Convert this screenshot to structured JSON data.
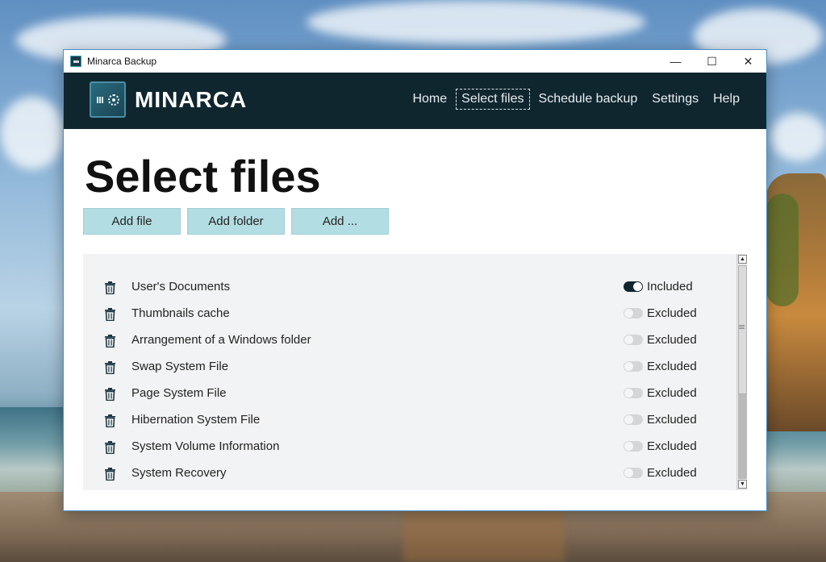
{
  "window": {
    "title": "Minarca Backup",
    "controls": {
      "minimize": "—",
      "maximize": "☐",
      "close": "✕"
    }
  },
  "header": {
    "brand": "MINARCA",
    "nav": [
      {
        "label": "Home",
        "active": false
      },
      {
        "label": "Select files",
        "active": true
      },
      {
        "label": "Schedule backup",
        "active": false
      },
      {
        "label": "Settings",
        "active": false
      },
      {
        "label": "Help",
        "active": false
      }
    ]
  },
  "page": {
    "title": "Select files",
    "buttons": {
      "add_file": "Add file",
      "add_folder": "Add folder",
      "add_more": "Add ..."
    }
  },
  "list": {
    "items": [
      {
        "label": "User's Documents",
        "status": "Included",
        "enabled": true
      },
      {
        "label": "Thumbnails cache",
        "status": "Excluded",
        "enabled": false
      },
      {
        "label": "Arrangement of a Windows folder",
        "status": "Excluded",
        "enabled": false
      },
      {
        "label": "Swap System File",
        "status": "Excluded",
        "enabled": false
      },
      {
        "label": "Page System File",
        "status": "Excluded",
        "enabled": false
      },
      {
        "label": "Hibernation System File",
        "status": "Excluded",
        "enabled": false
      },
      {
        "label": "System Volume Information",
        "status": "Excluded",
        "enabled": false
      },
      {
        "label": "System Recovery",
        "status": "Excluded",
        "enabled": false
      }
    ]
  },
  "icons": {
    "trash": "trash-icon",
    "app": "minarca-logo-icon"
  },
  "colors": {
    "header_bg": "#10262e",
    "button_bg": "#b2dde2",
    "panel_bg": "#f2f3f4",
    "toggle_on": "#10262e",
    "toggle_off": "#d4d6d8"
  }
}
